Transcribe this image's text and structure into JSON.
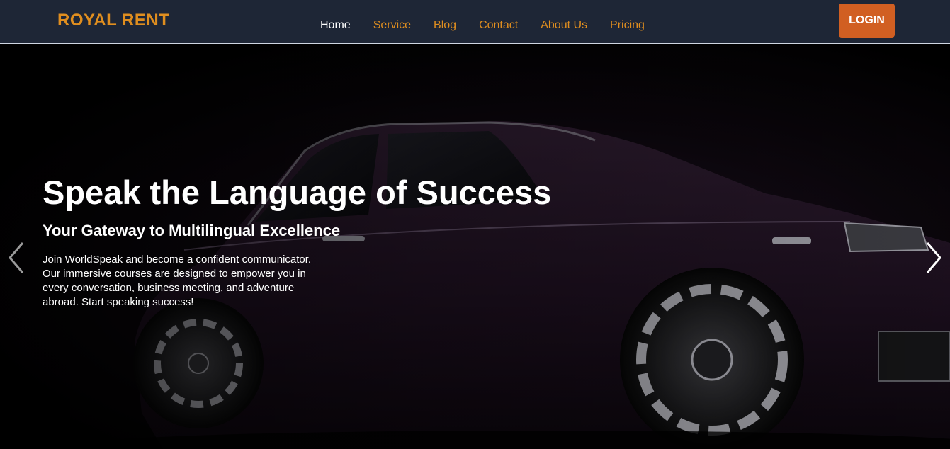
{
  "brand": {
    "name": "ROYAL RENT",
    "color": "#e08e1f"
  },
  "nav": {
    "items": [
      {
        "label": "Home",
        "active": true
      },
      {
        "label": "Service",
        "active": false
      },
      {
        "label": "Blog",
        "active": false
      },
      {
        "label": "Contact",
        "active": false
      },
      {
        "label": "About Us",
        "active": false
      },
      {
        "label": "Pricing",
        "active": false
      }
    ],
    "login_label": "LOGIN",
    "login_color": "#d15f22",
    "background": "#1e2636"
  },
  "hero": {
    "title": "Speak the Language of Success",
    "subtitle": "Your Gateway to Multilingual Excellence",
    "text": "Join WorldSpeak and become a confident communicator. Our immersive courses are designed to empower you in every conversation, business meeting, and adventure abroad. Start speaking success!",
    "prev_icon": "chevron-left-icon",
    "next_icon": "chevron-right-icon"
  }
}
